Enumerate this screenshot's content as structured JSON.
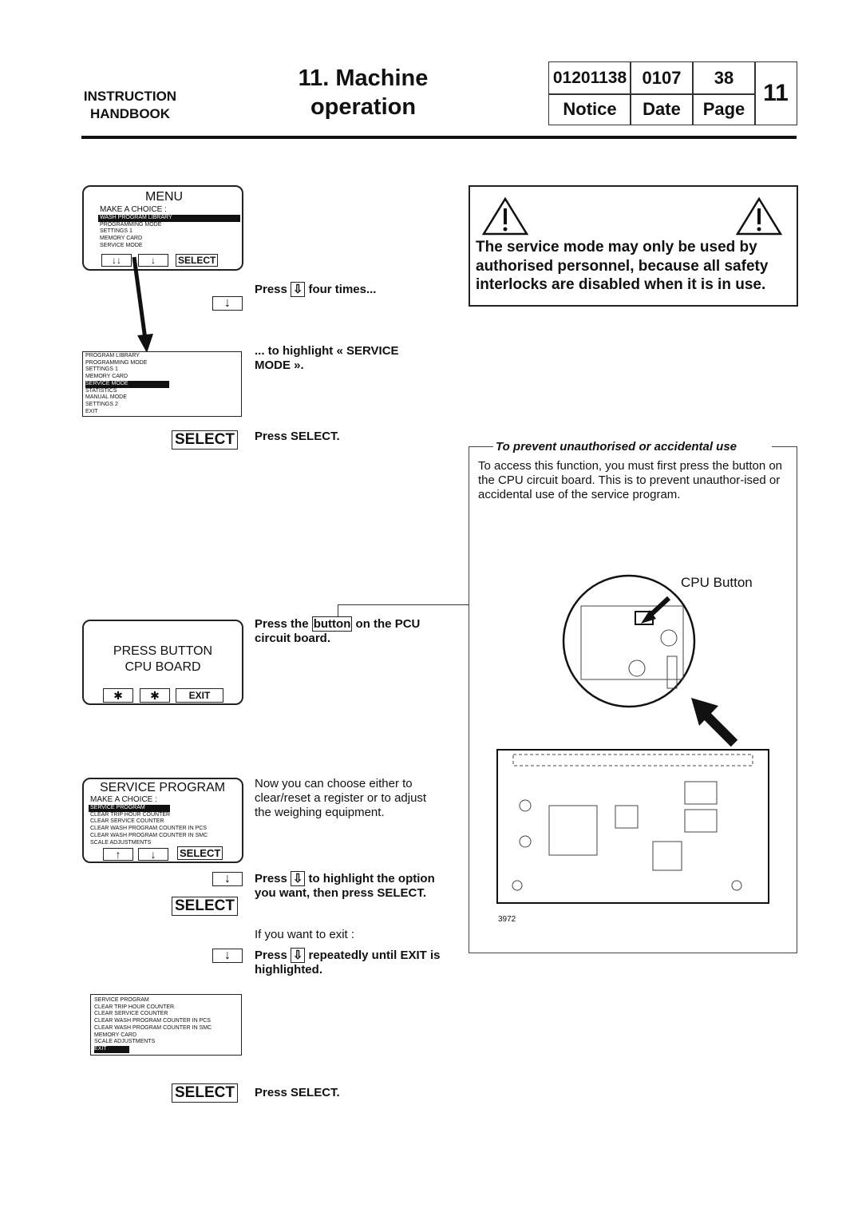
{
  "header": {
    "handbook": [
      "INSTRUCTION",
      "HANDBOOK"
    ],
    "title": [
      "11. Machine",
      "operation"
    ],
    "notice": "01201138",
    "notice_label": "Notice",
    "date": "0107",
    "date_label": "Date",
    "page": "38",
    "page_label": "Page",
    "chapter": "11"
  },
  "menu_screen": {
    "title": "MENU",
    "prompt": "MAKE A CHOICE :",
    "items": [
      "WASH PROGRAM LIBRARY",
      "PROGRAMMING MODE",
      "SETTINGS 1",
      "MEMORY CARD",
      "SERVICE MODE"
    ],
    "select": "SELECT"
  },
  "menu_screen2": {
    "items": [
      "PROGRAM LIBRARY",
      "PROGRAMMING MODE",
      "SETTINGS 1",
      "MEMORY CARD",
      "SERVICE MODE",
      "STATISTICS",
      "MANUAL MODE",
      "SETTINGS 2",
      "EXIT"
    ]
  },
  "steps": {
    "press_four_a": "Press",
    "press_four_b": "four times...",
    "highlight": "... to highlight « SERVICE MODE ».",
    "select": "SELECT",
    "press_select": "Press SELECT.",
    "press_button_a": "Press the",
    "press_button_word": "button",
    "press_button_b": "on the PCU circuit board.",
    "now": "Now you can choose either to clear/reset a register or to adjust the weighing equipment.",
    "press_hl_a": "Press",
    "press_hl_b": "to highlight the option you want, then press SELECT.",
    "exit_q": "If you want to exit :",
    "press_exit_a": "Press",
    "press_exit_b": "repeatedly until EXIT is highlighted.",
    "press_select2": "Press SELECT."
  },
  "cpu_screen": {
    "line1": "PRESS BUTTON",
    "line2": "CPU BOARD",
    "exit": "EXIT"
  },
  "service_screen": {
    "title": "SERVICE PROGRAM",
    "prompt": "MAKE A CHOICE :",
    "items": [
      "SERVICE PROGRAM",
      "CLEAR TRIP HOUR COUNTER",
      "CLEAR SERVICE COUNTER",
      "CLEAR WASH PROGRAM COUNTER IN PCS",
      "CLEAR WASH PROGRAM COUNTER IN SMC",
      "SCALE ADJUSTMENTS"
    ],
    "select": "SELECT"
  },
  "service_screen2": {
    "items": [
      "SERVICE PROGRAM",
      "CLEAR TRIP HOUR COUNTER",
      "CLEAR SERVICE COUNTER",
      "CLEAR WASH PROGRAM COUNTER IN PCS",
      "CLEAR WASH PROGRAM COUNTER IN SMC",
      "MEMORY CARD",
      "SCALE ADJUSTMENTS",
      "EXIT"
    ]
  },
  "warning": {
    "text": "The service mode may only be used by authorised personnel, because all safety interlocks are disabled when it is in use."
  },
  "prevent": {
    "title": "To prevent unauthorised or accidental use",
    "body": "To access this function, you must first press the button on the CPU circuit board. This is to prevent unauthor-ised or accidental use of the service program.",
    "cpu_label": "CPU Button",
    "figure": "3972"
  }
}
